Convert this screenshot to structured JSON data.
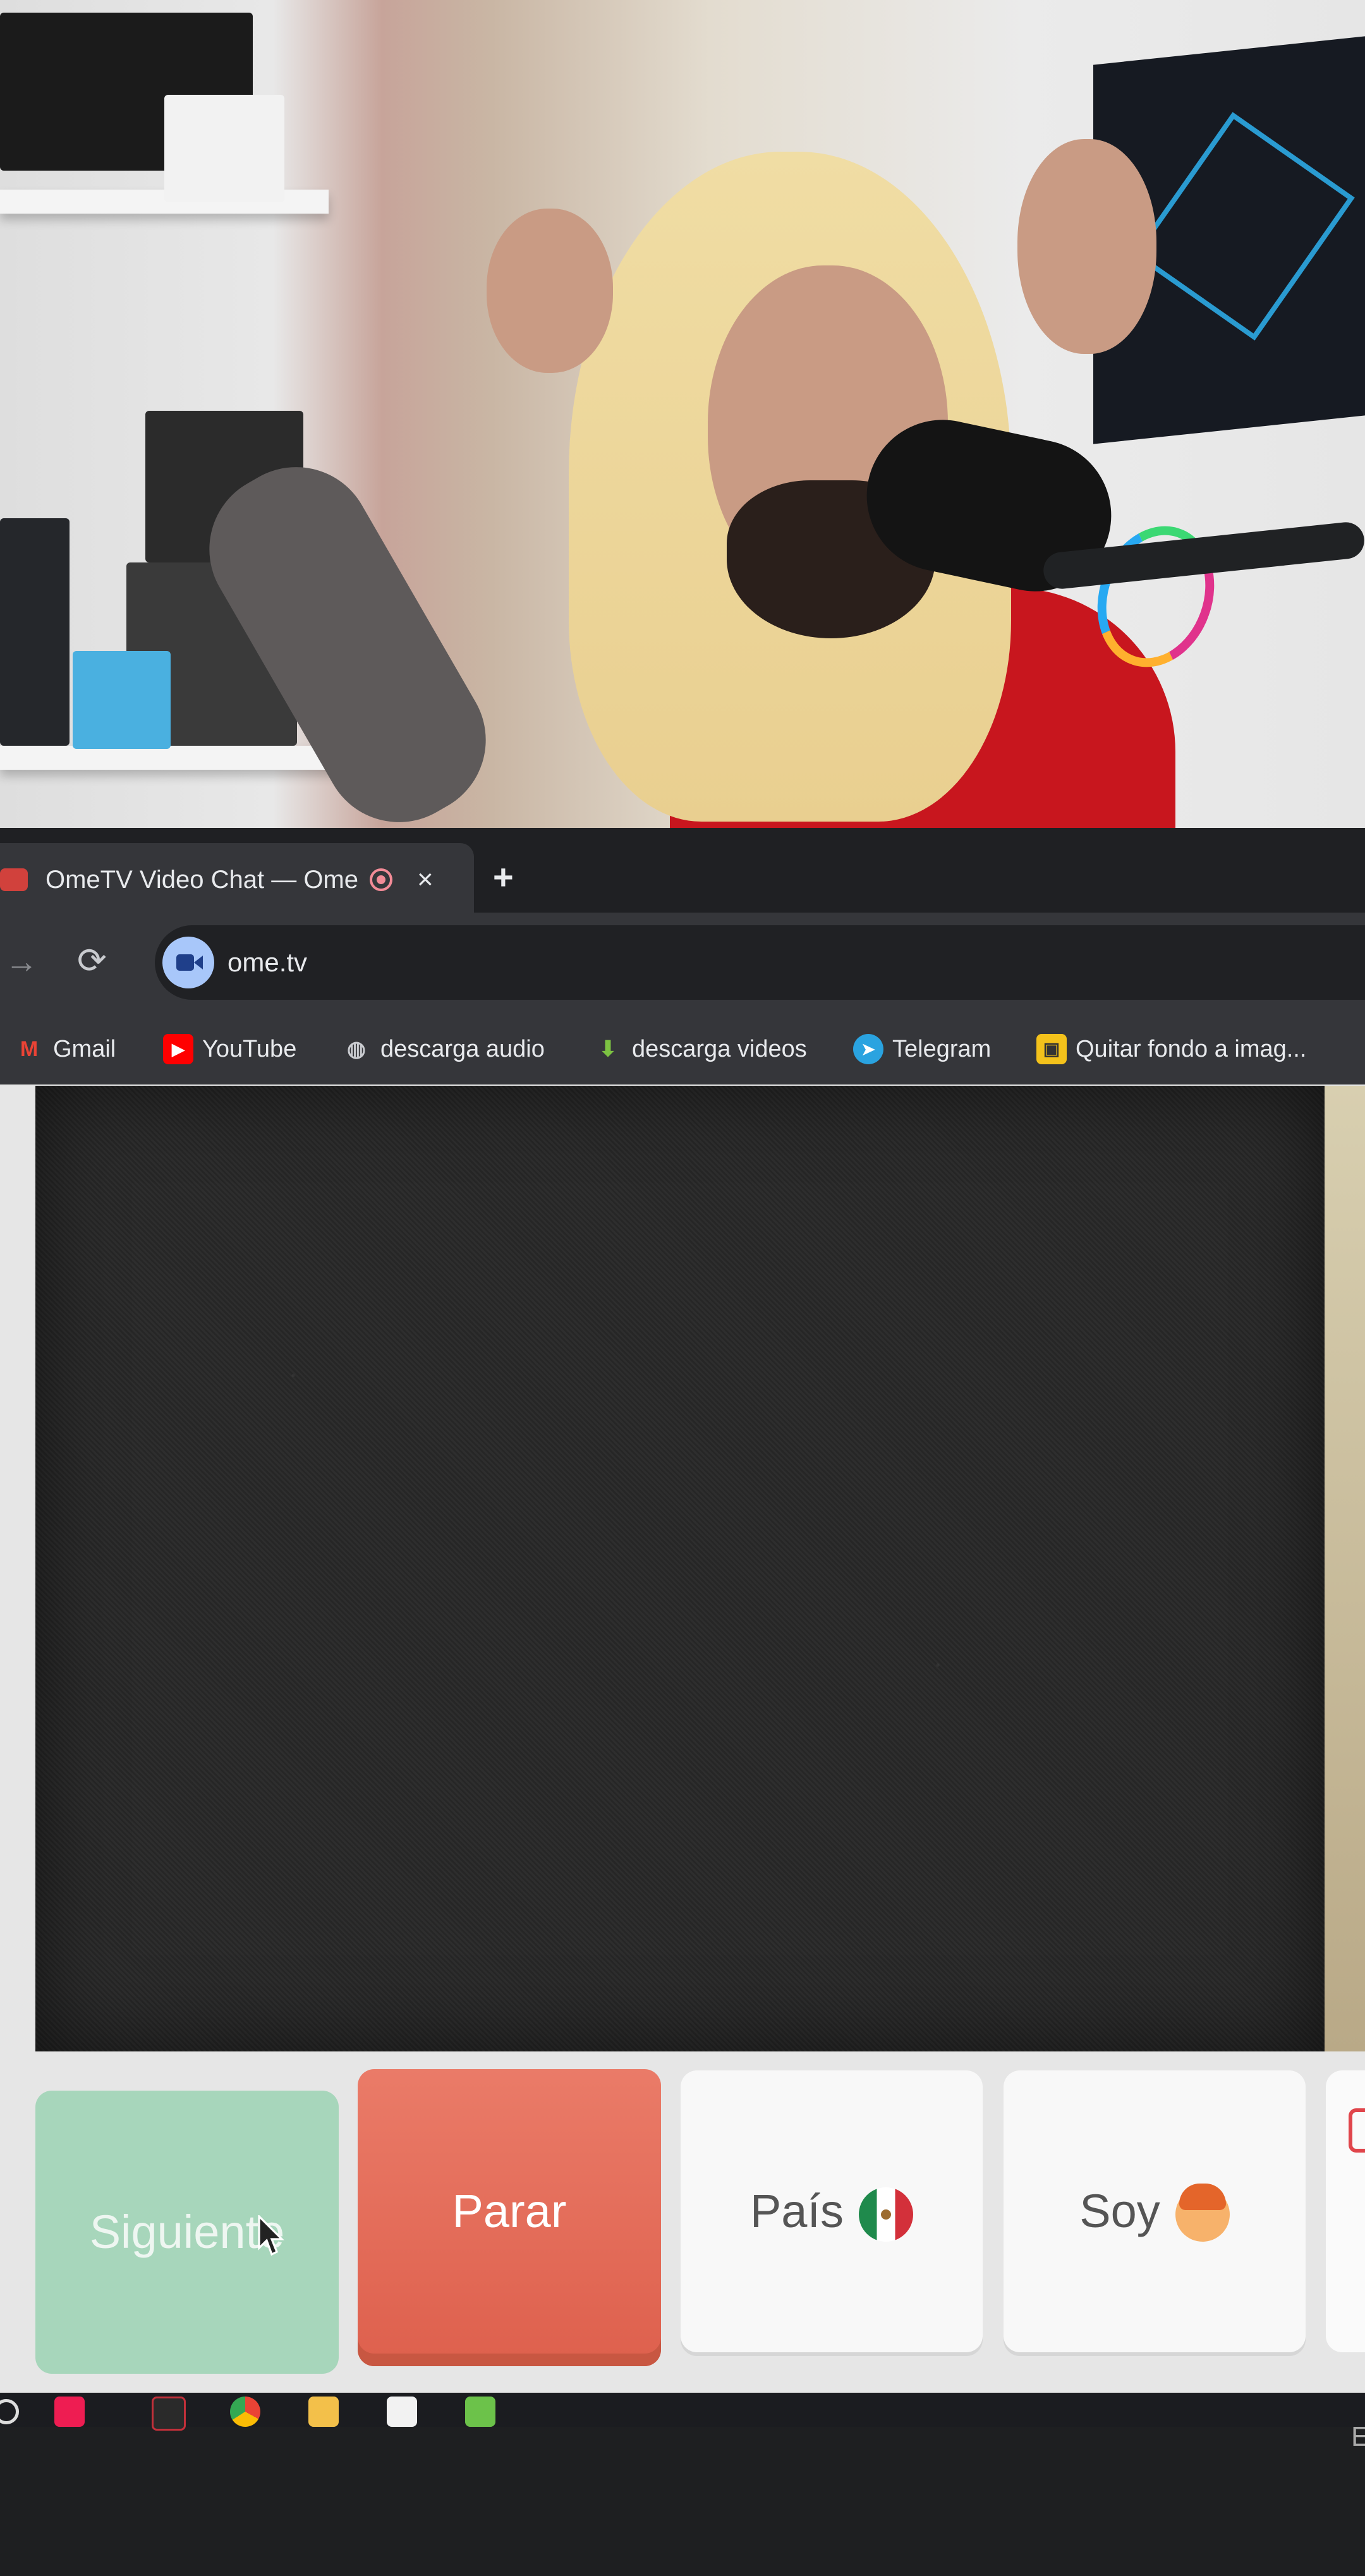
{
  "browser": {
    "tab": {
      "title": "OmeTV Video Chat — Ome",
      "favicon": "ometv-logo",
      "recording_icon": "record-icon",
      "close_symbol": "×"
    },
    "new_tab_symbol": "+",
    "address_bar": {
      "url": "ome.tv",
      "site_icon": "video-camera-icon"
    },
    "nav": {
      "forward_symbol": "→",
      "reload_symbol": "⟳"
    },
    "bookmarks": [
      {
        "label": "Gmail",
        "icon": "gmail-icon",
        "icon_glyph": "M",
        "color": "#ea4335"
      },
      {
        "label": "YouTube",
        "icon": "youtube-icon",
        "icon_glyph": "▶",
        "color": "#ff0000"
      },
      {
        "label": "descarga audio",
        "icon": "globe-icon",
        "icon_glyph": "◍",
        "color": "#9aa0a6"
      },
      {
        "label": "descarga videos",
        "icon": "download-arrow-icon",
        "icon_glyph": "⬇",
        "color": "#7cc242"
      },
      {
        "label": "Telegram",
        "icon": "telegram-icon",
        "icon_glyph": "➤",
        "color": "#2aa3e0"
      },
      {
        "label": "Quitar fondo a imag...",
        "icon": "remove-bg-icon",
        "icon_glyph": "▣",
        "color": "#f4c21b"
      }
    ]
  },
  "chat": {
    "buttons": {
      "next": "Siguiente",
      "stop": "Parar",
      "country": "País",
      "gender": "Soy"
    },
    "country_flag": "mexico-flag",
    "gender_icon": "boy-face-icon",
    "partial_right_text": "E"
  },
  "colors": {
    "next_button": "#a7d6bb",
    "stop_button": "#e56e5b",
    "neutral_button": "#f8f8f8"
  }
}
